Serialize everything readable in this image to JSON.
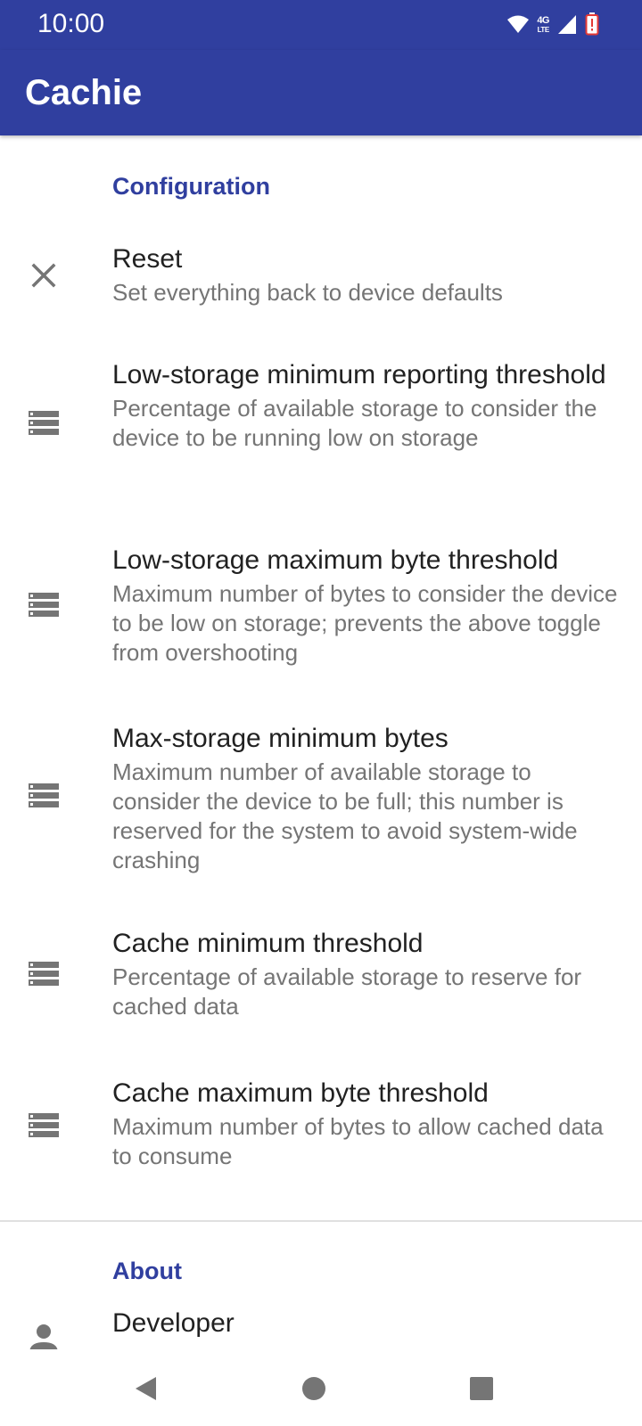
{
  "status_bar": {
    "time": "10:00",
    "network_type": "4G",
    "network_sub": "LTE",
    "icons": [
      "wifi-icon",
      "signal-icon",
      "battery-icon"
    ]
  },
  "app_bar": {
    "title": "Cachie"
  },
  "colors": {
    "primary": "#303f9f",
    "title_text": "#212121",
    "summary_text": "#757575",
    "icon": "#757575",
    "battery_alert": "#e53935"
  },
  "sections": [
    {
      "header": "Configuration",
      "items": [
        {
          "icon": "close-icon",
          "title": "Reset",
          "summary": "Set everything back to device defaults"
        },
        {
          "icon": "storage-list-icon",
          "title": "Low-storage minimum reporting threshold",
          "summary": "Percentage of available storage to consider the device to be running low on storage"
        },
        {
          "icon": "storage-list-icon",
          "title": "Low-storage maximum byte threshold",
          "summary": "Maximum number of bytes to consider the device to be low on storage; prevents the above toggle from overshooting"
        },
        {
          "icon": "storage-list-icon",
          "title": "Max-storage minimum bytes",
          "summary": "Maximum number of available storage to consider the device to be full; this number is reserved for the system to avoid system-wide crashing"
        },
        {
          "icon": "storage-list-icon",
          "title": "Cache minimum threshold",
          "summary": "Percentage of available storage to reserve for cached data"
        },
        {
          "icon": "storage-list-icon",
          "title": "Cache maximum byte threshold",
          "summary": "Maximum number of bytes to allow cached data to consume"
        }
      ]
    },
    {
      "header": "About",
      "items": [
        {
          "icon": "person-icon",
          "title": "Developer",
          "summary": ""
        }
      ]
    }
  ],
  "nav_bar": {
    "buttons": [
      "back-icon",
      "home-icon",
      "recents-icon"
    ]
  }
}
